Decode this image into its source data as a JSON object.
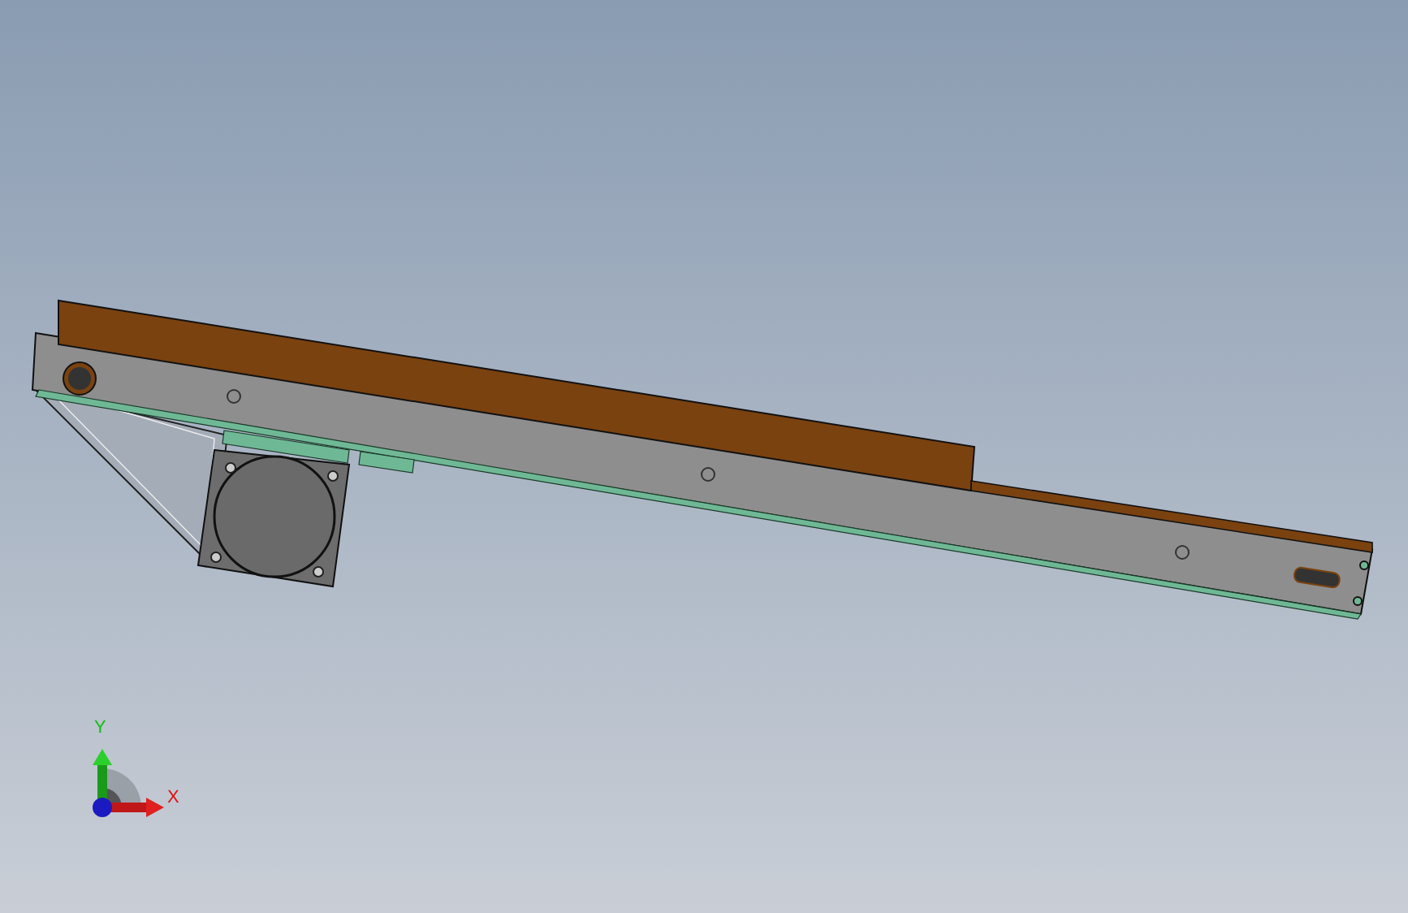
{
  "triad": {
    "axes": [
      {
        "kind": "y",
        "label": "Y"
      },
      {
        "kind": "x",
        "label": "X"
      }
    ]
  }
}
